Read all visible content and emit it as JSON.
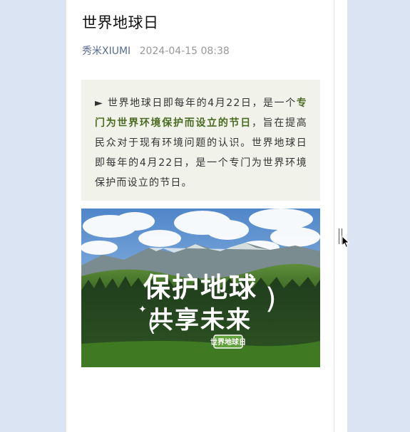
{
  "article": {
    "title": "世界地球日",
    "author": "秀米XIUMI",
    "date": "2024-04-15 08:38"
  },
  "quote": {
    "arrow": "►",
    "part1": " 世界地球日即每年的4月22日，是一个",
    "highlight": "专门为世界环境保护而设立的节日",
    "part2": "，旨在提高民众对于现有环境问题的认识。世界地球日即每年的4月22日，是一个专门为世界环境保护而设立的节日。",
    "highlight_color": "#4a6b21",
    "background_color": "#f1f2ea"
  },
  "hero_image": {
    "slogan_line1": "保护地球",
    "slogan_line2": "共享未来",
    "badge": "世界地球日"
  }
}
